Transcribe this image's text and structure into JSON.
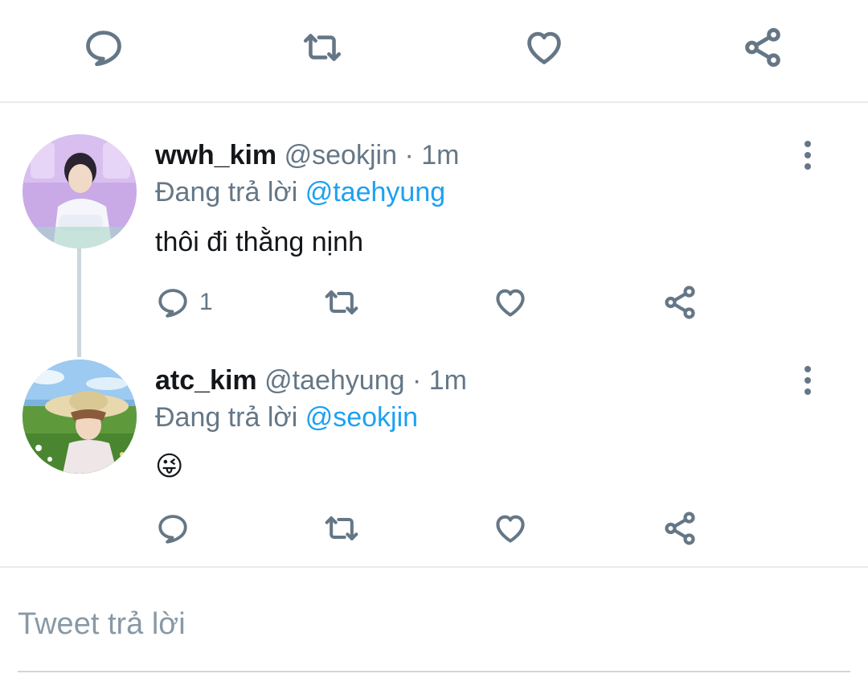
{
  "top_actions": {
    "icons": [
      "reply-icon",
      "retweet-icon",
      "like-icon",
      "share-icon"
    ]
  },
  "tweets": [
    {
      "display_name": "wwh_kim",
      "handle": "@seokjin",
      "time": "· 1m",
      "reply_prefix": "Đang trả lời",
      "reply_to": "@taehyung",
      "text": "thôi đi thằng nịnh",
      "reply_count": "1"
    },
    {
      "display_name": "atc_kim",
      "handle": "@taehyung",
      "time": "· 1m",
      "reply_prefix": "Đang trả lời",
      "reply_to": "@seokjin",
      "text": "😜",
      "reply_count": ""
    }
  ],
  "compose": {
    "placeholder": "Tweet trả lời",
    "value": ""
  },
  "colors": {
    "accent": "#1da1f2",
    "icon": "#657786",
    "divider": "#e6ecf0"
  }
}
